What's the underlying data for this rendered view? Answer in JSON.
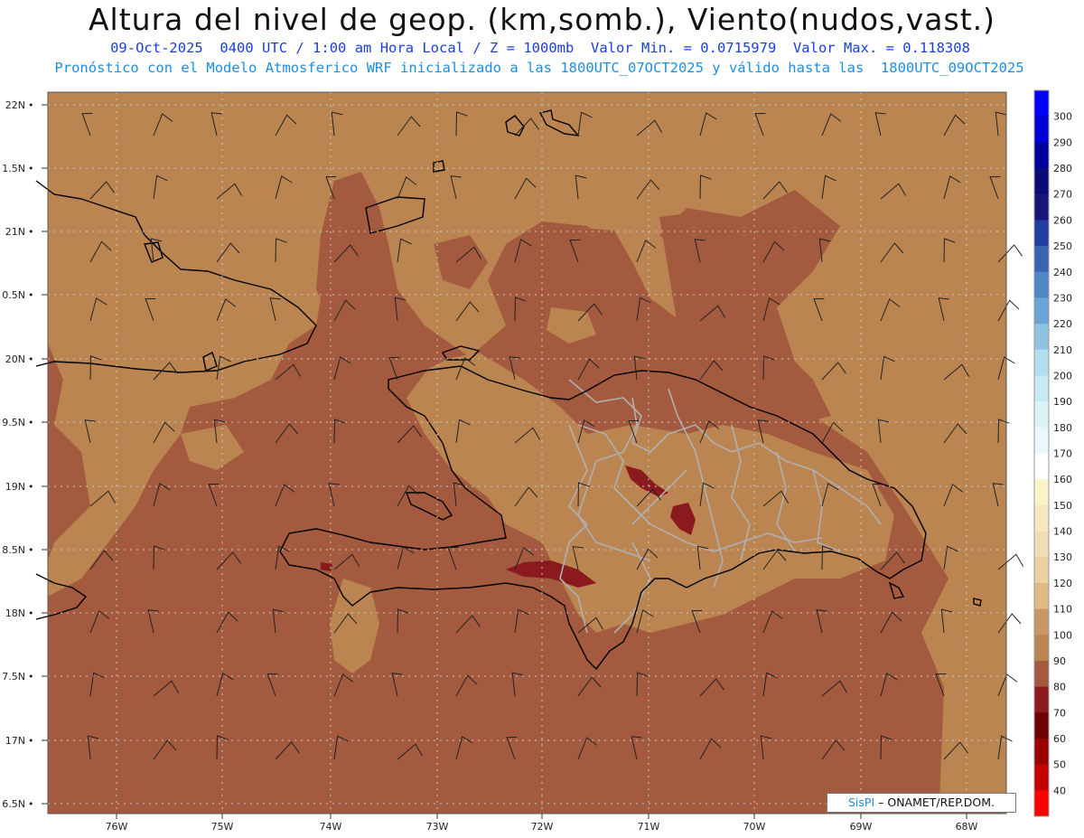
{
  "title": "Altura del nivel de geop. (km,somb.), Viento(nudos,vast.)",
  "subtitle_line1": "09-Oct-2025  0400 UTC / 1:00 am Hora Local / Z = 1000mb  Valor Min. = 0.0715979  Valor Max. = 0.118308",
  "subtitle_line2": "Pronóstico con el Modelo Atmosferico WRF inicializado a las 1800UTC_07OCT2025 y válido hasta las  1800UTC_09OCT2025",
  "map": {
    "lat_labels": [
      "22N",
      "1.5N",
      "21N",
      "0.5N",
      "20N",
      "9.5N",
      "19N",
      "8.5N",
      "18N",
      "7.5N",
      "17N",
      "6.5N"
    ],
    "lon_labels": [
      "76W",
      "75W",
      "74W",
      "73W",
      "72W",
      "71W",
      "70W",
      "69W",
      "68W"
    ],
    "field_colors": {
      "level_90_100": "#a45a3e",
      "level_100_110": "#bb8551",
      "level_80_90": "#8b1a1e"
    },
    "coastline_color": "#000000",
    "province_border_color": "#b0b0b0"
  },
  "colorbar": {
    "labels": [
      "300",
      "290",
      "280",
      "270",
      "260",
      "250",
      "240",
      "230",
      "220",
      "210",
      "200",
      "190",
      "180",
      "170",
      "160",
      "150",
      "140",
      "130",
      "120",
      "110",
      "100",
      "90",
      "80",
      "70",
      "60",
      "50",
      "40"
    ],
    "colors": [
      "#0000ff",
      "#0000d6",
      "#00009e",
      "#0a0a78",
      "#15157a",
      "#233ea0",
      "#3a63b2",
      "#4e86c6",
      "#6aa3d4",
      "#8fc3e2",
      "#b1dfee",
      "#c6e9f2",
      "#dcf2f8",
      "#ebf8fb",
      "#ffffff",
      "#fbf1cb",
      "#f6e8c1",
      "#f1ddb4",
      "#ead0a2",
      "#dfb986",
      "#c99765",
      "#bb8551",
      "#a45a3e",
      "#8b1a1e",
      "#6e0000",
      "#9b0000",
      "#c40000",
      "#ff0000"
    ]
  },
  "credit": {
    "brand": "SisPI",
    "text": " – ONAMET/REP.DOM."
  }
}
